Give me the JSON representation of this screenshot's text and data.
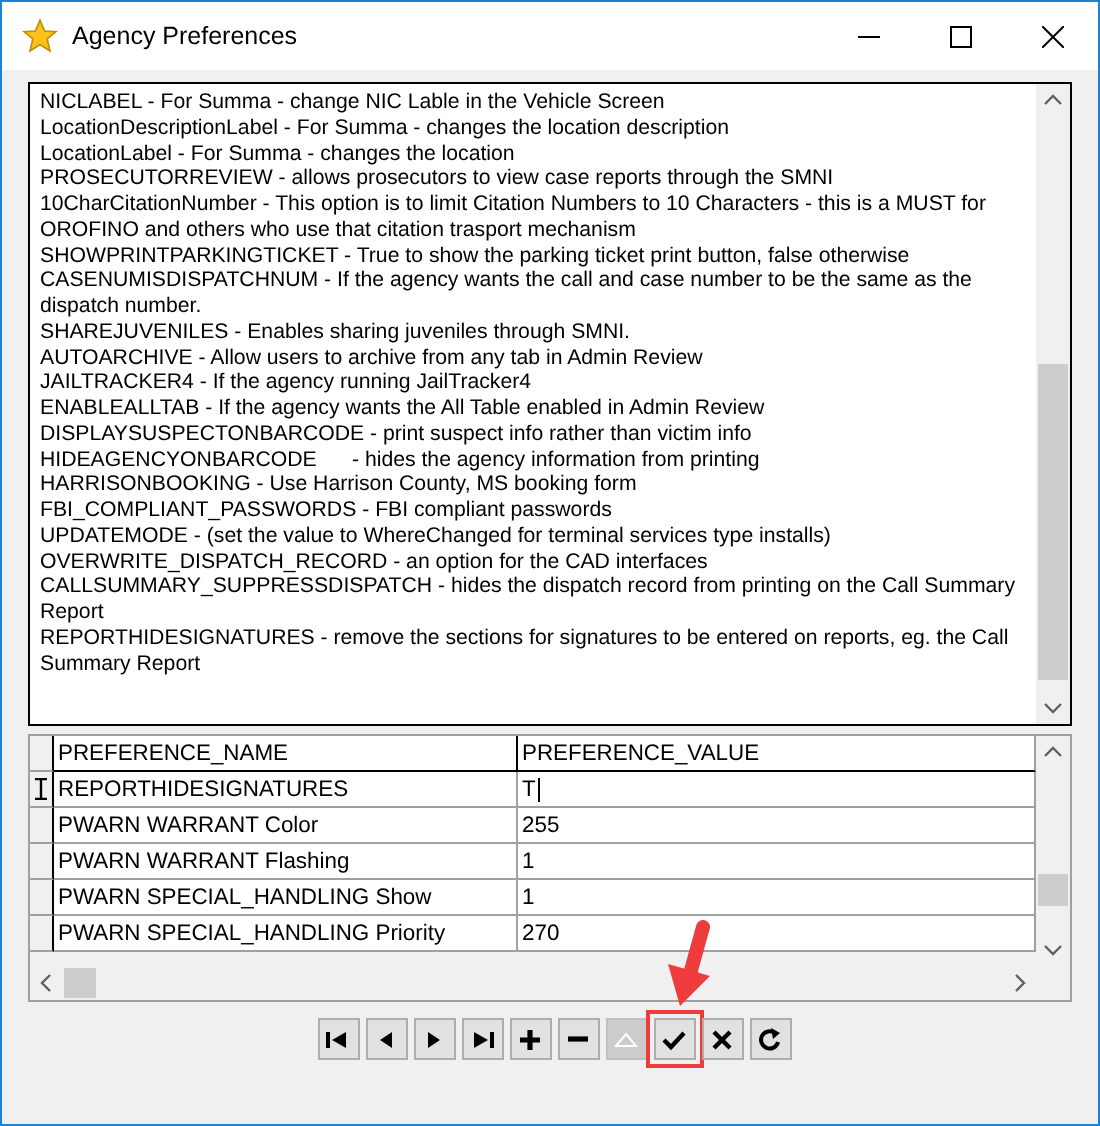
{
  "window": {
    "title": "Agency Preferences"
  },
  "descriptions": [
    "NICLABEL - For Summa - change NIC Lable in the Vehicle Screen",
    "LocationDescriptionLabel - For Summa - changes the location description",
    "LocationLabel - For Summa - changes the location",
    "PROSECUTORREVIEW - allows prosecutors to view case reports through the SMNI",
    "10CharCitationNumber - This option is to limit Citation Numbers to 10 Characters - this is a MUST for OROFINO and others who use that citation trasport mechanism",
    "SHOWPRINTPARKINGTICKET - True to show the parking ticket print button, false otherwise",
    "CASENUMISDISPATCHNUM - If the agency wants the call and case number to be the same as the dispatch number.",
    "SHAREJUVENILES - Enables sharing juveniles through SMNI.",
    "AUTOARCHIVE - Allow users to archive from any tab in Admin Review",
    "JAILTRACKER4 - If the agency running JailTracker4",
    "ENABLEALLTAB - If the agency wants the All Table enabled in Admin Review",
    "DISPLAYSUSPECTONBARCODE - print suspect info rather than victim info",
    "HIDEAGENCYONBARCODE      - hides the agency information from printing",
    "HARRISONBOOKING - Use Harrison County, MS booking form",
    "FBI_COMPLIANT_PASSWORDS - FBI compliant passwords",
    "UPDATEMODE - (set the value to WhereChanged for terminal services type installs)",
    "OVERWRITE_DISPATCH_RECORD - an option for the CAD interfaces",
    "CALLSUMMARY_SUPPRESSDISPATCH - hides the dispatch record from printing on the Call Summary Report",
    "REPORTHIDESIGNATURES - remove the sections for signatures to be entered on reports, eg. the Call Summary Report"
  ],
  "grid": {
    "columns": [
      "PREFERENCE_NAME",
      "PREFERENCE_VALUE"
    ],
    "rows": [
      {
        "name": "REPORTHIDESIGNATURES",
        "value": "T",
        "selected": true,
        "editing": true
      },
      {
        "name": "PWARN WARRANT Color",
        "value": "255",
        "selected": false,
        "editing": false
      },
      {
        "name": "PWARN WARRANT Flashing",
        "value": "1",
        "selected": false,
        "editing": false
      },
      {
        "name": "PWARN SPECIAL_HANDLING Show",
        "value": "1",
        "selected": false,
        "editing": false
      },
      {
        "name": "PWARN SPECIAL_HANDLING Priority",
        "value": "270",
        "selected": false,
        "editing": false
      }
    ]
  },
  "navigator": [
    {
      "kind": "first",
      "disabled": false,
      "highlighted": false
    },
    {
      "kind": "prior",
      "disabled": false,
      "highlighted": false
    },
    {
      "kind": "next",
      "disabled": false,
      "highlighted": false
    },
    {
      "kind": "last",
      "disabled": false,
      "highlighted": false
    },
    {
      "kind": "insert",
      "disabled": false,
      "highlighted": false
    },
    {
      "kind": "delete",
      "disabled": false,
      "highlighted": false
    },
    {
      "kind": "edit",
      "disabled": true,
      "highlighted": false
    },
    {
      "kind": "post",
      "disabled": false,
      "highlighted": true
    },
    {
      "kind": "cancel",
      "disabled": false,
      "highlighted": false
    },
    {
      "kind": "refresh",
      "disabled": false,
      "highlighted": false
    }
  ]
}
